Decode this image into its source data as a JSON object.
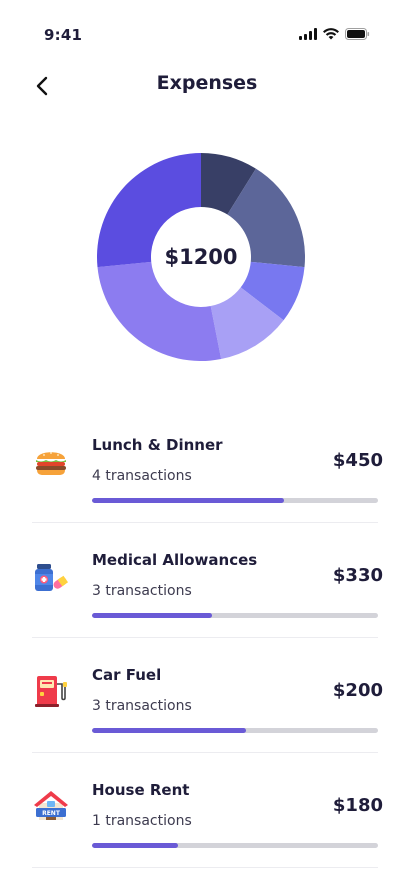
{
  "status_bar": {
    "time": "9:41"
  },
  "header": {
    "title": "Expenses"
  },
  "chart_data": {
    "type": "pie",
    "center_label": "$1200",
    "series": [
      {
        "value": 1,
        "color": "#383f66"
      },
      {
        "value": 2,
        "color": "#5c6699"
      },
      {
        "value": 1,
        "color": "#7878f0"
      },
      {
        "value": 1.3,
        "color": "#a8a0f5"
      },
      {
        "value": 3,
        "color": "#8c7cf0"
      },
      {
        "value": 3,
        "color": "#5b4de0"
      }
    ]
  },
  "expenses": [
    {
      "name": "Lunch & Dinner",
      "count": "4 transactions",
      "amount": "$450",
      "progress": 0.67,
      "icon": "burger-icon"
    },
    {
      "name": "Medical Allowances",
      "count": "3 transactions",
      "amount": "$330",
      "progress": 0.42,
      "icon": "medicine-icon"
    },
    {
      "name": "Car Fuel",
      "count": "3 transactions",
      "amount": "$200",
      "progress": 0.54,
      "icon": "fuel-pump-icon"
    },
    {
      "name": "House Rent",
      "count": "1 transactions",
      "amount": "$180",
      "progress": 0.3,
      "icon": "house-rent-icon"
    }
  ]
}
